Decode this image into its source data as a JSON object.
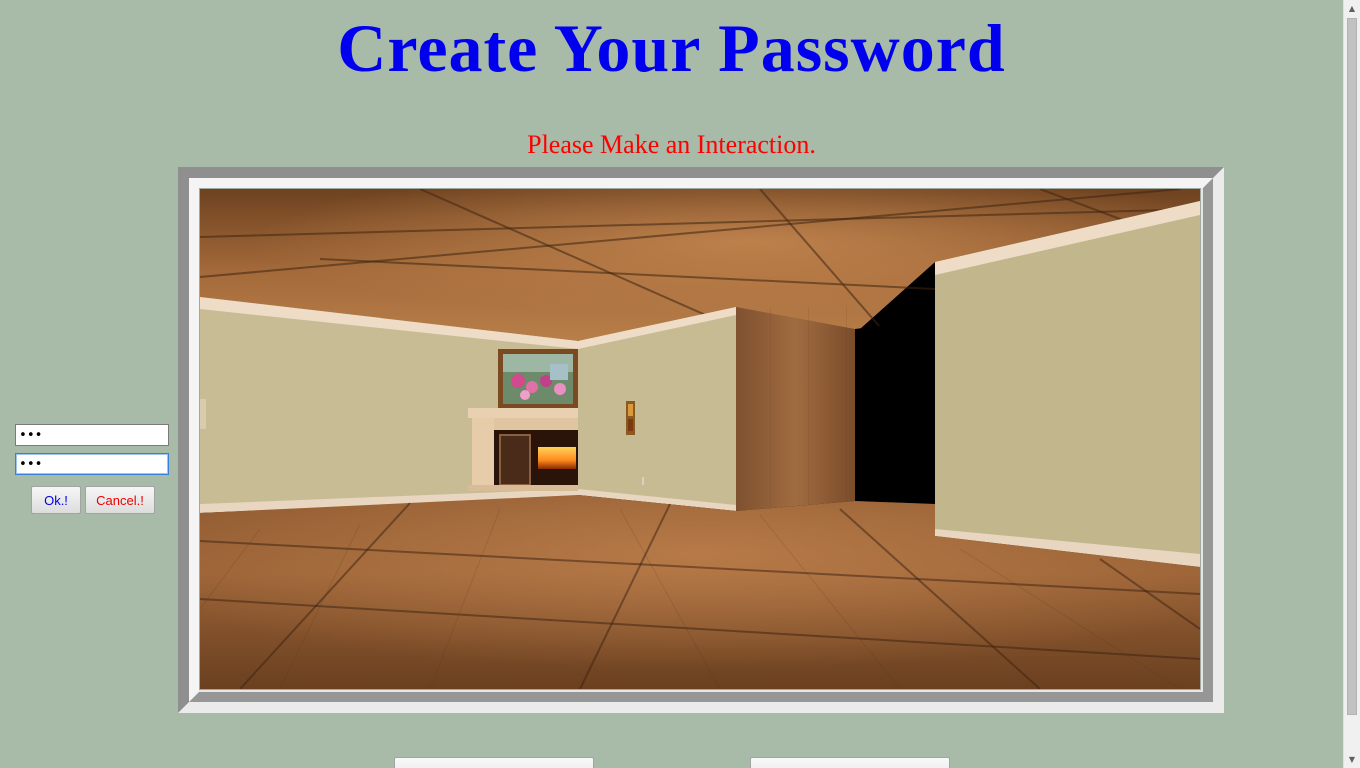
{
  "page": {
    "title": "Create Your Password",
    "instruction": "Please Make an Interaction."
  },
  "controls": {
    "password1_value": "abc",
    "password2_value": "abc",
    "ok_label": "Ok.!",
    "cancel_label": "Cancel.!"
  },
  "scene": {
    "description_icon": "3d-room-view",
    "objects": [
      "fireplace",
      "painting-flowers",
      "small-wall-picture",
      "light-switch",
      "doorway",
      "wooden-pillar"
    ]
  },
  "colors": {
    "background": "#a8baa8",
    "title": "#0000ee",
    "instruction": "#ff0000",
    "ok_text": "#0000ee",
    "cancel_text": "#ee0000"
  },
  "scrollbar": {
    "up_icon": "scroll-up-arrow-icon",
    "down_icon": "scroll-down-arrow-icon"
  }
}
